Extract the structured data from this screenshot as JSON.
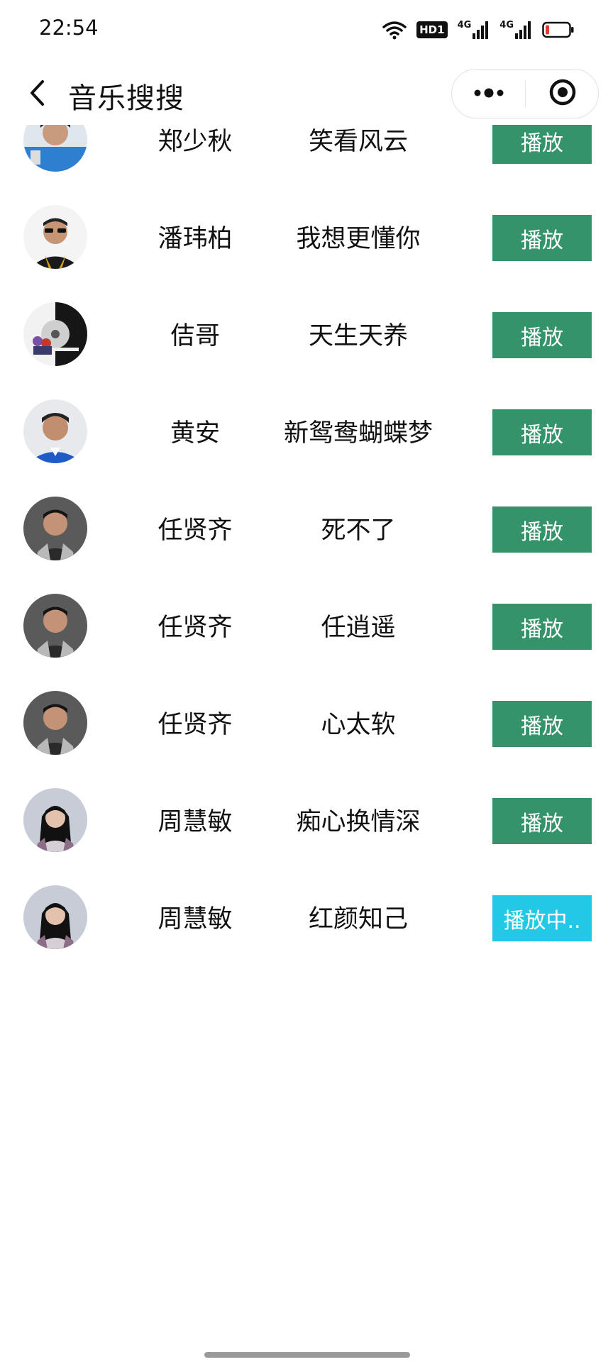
{
  "status_bar": {
    "time": "22:54",
    "icons": [
      "wifi-icon",
      "hd-icon",
      "signal-4g-icon",
      "signal-4g-r-icon",
      "battery-low-icon"
    ],
    "hd_label": "HD1",
    "net1_label": "4G",
    "net2_label": "4G",
    "battery_color": "#e53935"
  },
  "nav": {
    "title": "音乐搜搜",
    "back_icon": "chevron-left-icon",
    "more_icon": "more-dots-icon",
    "close_icon": "target-circle-icon"
  },
  "colors": {
    "play_button": "#35936a",
    "playing_button": "#22c9e6"
  },
  "songs": [
    {
      "singer": "郑少秋",
      "title": "笑看风云",
      "button": "播放",
      "playing": false
    },
    {
      "singer": "潘玮柏",
      "title": "我想更懂你",
      "button": "播放",
      "playing": false
    },
    {
      "singer": "佶哥",
      "title": "天生天养",
      "button": "播放",
      "playing": false
    },
    {
      "singer": "黄安",
      "title": "新鸳鸯蝴蝶梦",
      "button": "播放",
      "playing": false
    },
    {
      "singer": "任贤齐",
      "title": "死不了",
      "button": "播放",
      "playing": false
    },
    {
      "singer": "任贤齐",
      "title": "任逍遥",
      "button": "播放",
      "playing": false
    },
    {
      "singer": "任贤齐",
      "title": "心太软",
      "button": "播放",
      "playing": false
    },
    {
      "singer": "周慧敏",
      "title": "痴心换情深",
      "button": "播放",
      "playing": false
    },
    {
      "singer": "周慧敏",
      "title": "红颜知己",
      "button": "播放中..",
      "playing": true
    }
  ]
}
